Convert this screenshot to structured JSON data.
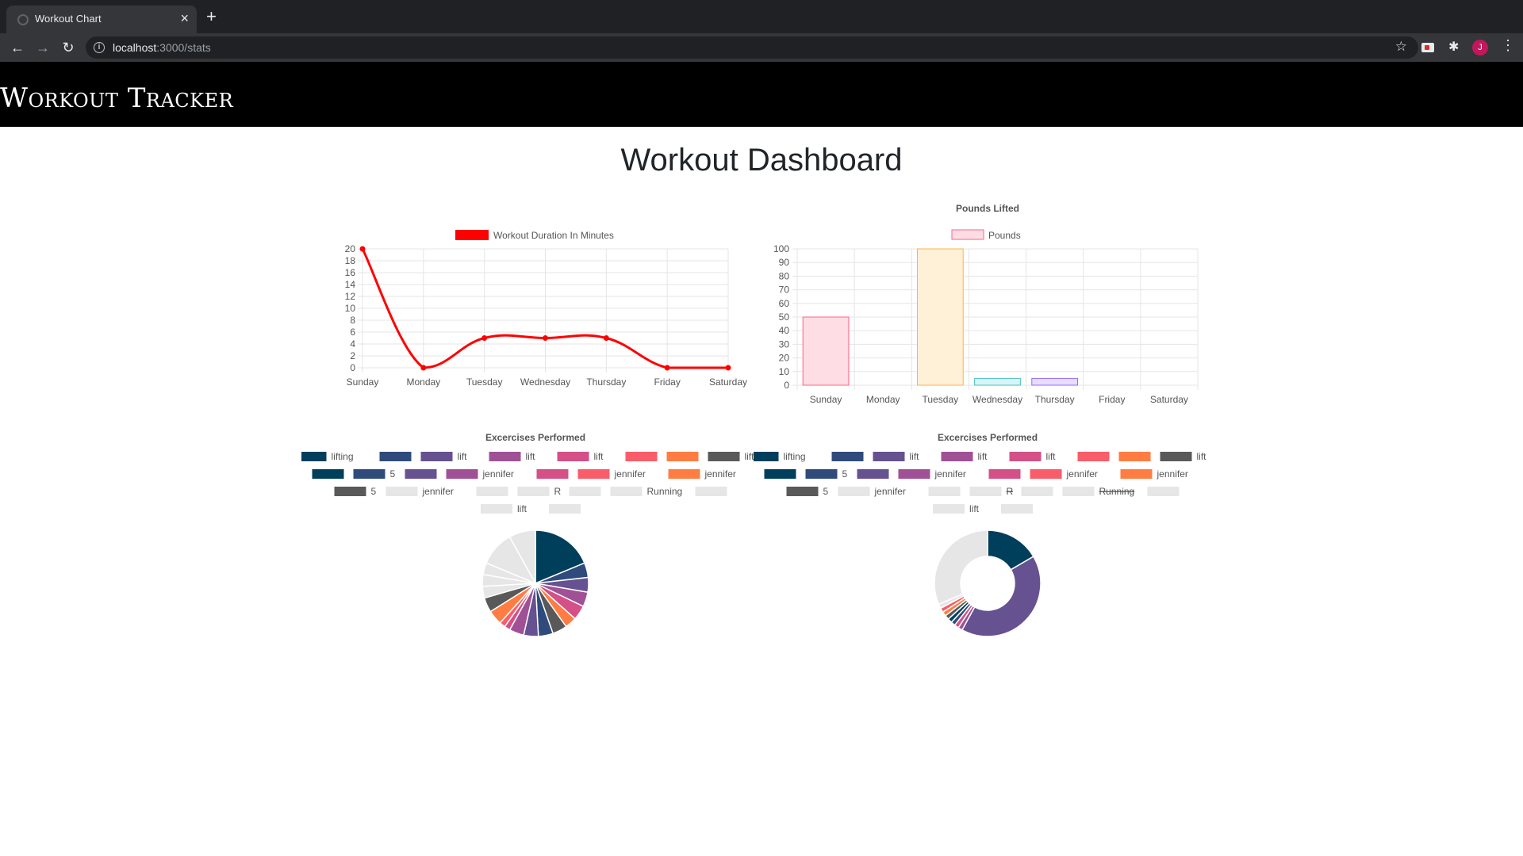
{
  "browser": {
    "tab_title": "Workout Chart",
    "url_host": "localhost",
    "url_rest": ":3000/stats",
    "profile_initial": "J"
  },
  "header": {
    "brand": "Workout Tracker"
  },
  "main": {
    "title": "Workout Dashboard"
  },
  "colors": {
    "line": "#ff0000",
    "palette": [
      "#003f5c",
      "#2f4b7c",
      "#665191",
      "#a05195",
      "#d45087",
      "#f95d6a",
      "#ff7c43",
      "#595959",
      "#e6e6e6"
    ]
  },
  "chart_data": [
    {
      "type": "line",
      "title": "",
      "legend": [
        "Workout Duration In Minutes"
      ],
      "categories": [
        "Sunday",
        "Monday",
        "Tuesday",
        "Wednesday",
        "Thursday",
        "Friday",
        "Saturday"
      ],
      "series": [
        {
          "name": "Workout Duration In Minutes",
          "values": [
            20,
            0,
            5,
            5,
            5,
            0,
            0
          ]
        }
      ],
      "ylim": [
        0,
        20
      ],
      "yticks": [
        0,
        2,
        4,
        6,
        8,
        10,
        12,
        14,
        16,
        18,
        20
      ],
      "grid": true,
      "legend_position": "top"
    },
    {
      "type": "bar",
      "title": "Pounds Lifted",
      "legend": [
        "Pounds"
      ],
      "categories": [
        "Sunday",
        "Monday",
        "Tuesday",
        "Wednesday",
        "Thursday",
        "Friday",
        "Saturday"
      ],
      "series": [
        {
          "name": "Pounds",
          "values": [
            50,
            0,
            100,
            5,
            5,
            0,
            0
          ]
        }
      ],
      "bar_fills": [
        "#ffdde4",
        "#fff0d8",
        "#fff0d8",
        "#d8f4f4",
        "#e6ddff",
        "#ffffff",
        "#ffffff"
      ],
      "bar_strokes": [
        "#ff6384",
        "#ffb14a",
        "#ffb14a",
        "#4bc0c0",
        "#9966ff",
        "#cccccc",
        "#cccccc"
      ],
      "ylim": [
        0,
        100
      ],
      "yticks": [
        0,
        10,
        20,
        30,
        40,
        50,
        60,
        70,
        80,
        90,
        100
      ],
      "grid": true,
      "legend_position": "top"
    },
    {
      "type": "pie",
      "title": "Excercises Performed",
      "legend_position": "top",
      "legend_rows": [
        [
          {
            "label": "lifting",
            "c": 0
          },
          {
            "label": "",
            "c": 1
          },
          {
            "label": "lift",
            "c": 2
          },
          {
            "label": "lift",
            "c": 3
          },
          {
            "label": "lift",
            "c": 4
          },
          {
            "label": "",
            "c": 5
          },
          {
            "label": "",
            "c": 6
          },
          {
            "label": "lift",
            "c": 7
          }
        ],
        [
          {
            "label": "",
            "c": 0
          },
          {
            "label": "5",
            "c": 1
          },
          {
            "label": "",
            "c": 2
          },
          {
            "label": "jennifer",
            "c": 3
          },
          {
            "label": "",
            "c": 4
          },
          {
            "label": "jennifer",
            "c": 5
          },
          {
            "label": "jennifer",
            "c": 6
          }
        ],
        [
          {
            "label": "5",
            "c": 7
          },
          {
            "label": "jennifer",
            "c": 8
          },
          {
            "label": "",
            "c": 8
          },
          {
            "label": "R",
            "c": 8
          },
          {
            "label": "",
            "c": 8
          },
          {
            "label": "Running",
            "c": 8
          },
          {
            "label": "",
            "c": 8
          }
        ],
        [
          {
            "label": "lift",
            "c": 8
          },
          {
            "label": "",
            "c": 8
          }
        ]
      ],
      "slices": [
        {
          "value": 21,
          "c": 0
        },
        {
          "value": 5,
          "c": 1
        },
        {
          "value": 5,
          "c": 2
        },
        {
          "value": 5,
          "c": 3
        },
        {
          "value": 5,
          "c": 4
        },
        {
          "value": 4,
          "c": 6
        },
        {
          "value": 5,
          "c": 7
        },
        {
          "value": 5,
          "c": 1
        },
        {
          "value": 5,
          "c": 2
        },
        {
          "value": 5,
          "c": 3
        },
        {
          "value": 2,
          "c": 4
        },
        {
          "value": 2,
          "c": 5
        },
        {
          "value": 5,
          "c": 6
        },
        {
          "value": 5,
          "c": 7
        },
        {
          "value": 4,
          "c": 8
        },
        {
          "value": 4,
          "c": 8
        },
        {
          "value": 4,
          "c": 8
        },
        {
          "value": 12,
          "c": 8
        },
        {
          "value": 9,
          "c": 8
        }
      ]
    },
    {
      "type": "doughnut",
      "title": "Excercises Performed",
      "legend_position": "top",
      "legend_rows": [
        [
          {
            "label": "lifting",
            "c": 0
          },
          {
            "label": "",
            "c": 1
          },
          {
            "label": "lift",
            "c": 2
          },
          {
            "label": "lift",
            "c": 3
          },
          {
            "label": "lift",
            "c": 4
          },
          {
            "label": "",
            "c": 5
          },
          {
            "label": "",
            "c": 6
          },
          {
            "label": "lift",
            "c": 7
          }
        ],
        [
          {
            "label": "",
            "c": 0
          },
          {
            "label": "5",
            "c": 1
          },
          {
            "label": "",
            "c": 2
          },
          {
            "label": "jennifer",
            "c": 3
          },
          {
            "label": "",
            "c": 4
          },
          {
            "label": "jennifer",
            "c": 5
          },
          {
            "label": "jennifer",
            "c": 6
          }
        ],
        [
          {
            "label": "5",
            "c": 7
          },
          {
            "label": "jennifer",
            "c": 8
          },
          {
            "label": "",
            "c": 8
          },
          {
            "label": "R",
            "c": 8,
            "strike": true
          },
          {
            "label": "",
            "c": 8
          },
          {
            "label": "Running",
            "c": 8,
            "strike": true
          },
          {
            "label": "",
            "c": 8
          }
        ],
        [
          {
            "label": "lift",
            "c": 8
          },
          {
            "label": "",
            "c": 8
          }
        ]
      ],
      "slices": [
        {
          "value": 100,
          "c": 0
        },
        {
          "value": 250,
          "c": 2
        },
        {
          "value": 8,
          "c": 3
        },
        {
          "value": 8,
          "c": 4
        },
        {
          "value": 8,
          "c": 1
        },
        {
          "value": 8,
          "c": 0
        },
        {
          "value": 8,
          "c": 7
        },
        {
          "value": 8,
          "c": 6
        },
        {
          "value": 8,
          "c": 5
        },
        {
          "value": 8,
          "c": 8
        },
        {
          "value": 190,
          "c": 8
        }
      ]
    }
  ]
}
